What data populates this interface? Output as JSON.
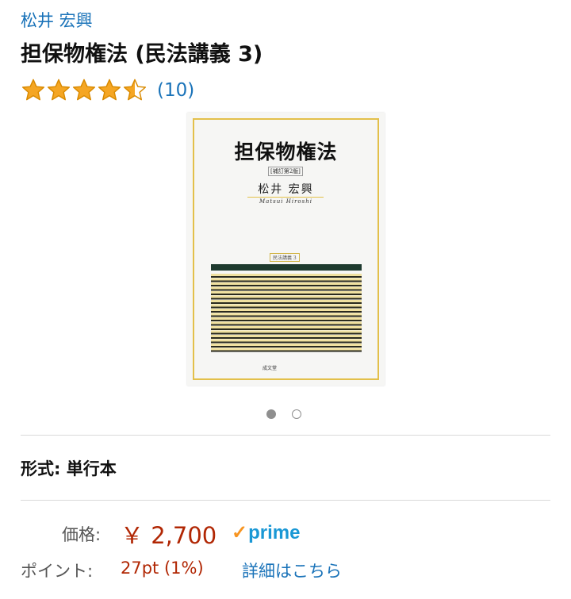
{
  "product": {
    "author": "松井 宏興",
    "title": "担保物権法 (民法講義 3)",
    "rating": {
      "stars": 4.5,
      "max_stars": 5,
      "count_text": "(10)"
    }
  },
  "cover": {
    "title": "担保物権法",
    "edition": "[補訂第2版]",
    "author": "松井 宏興",
    "author_en": "Matsui  Hiroshi",
    "series": "民法講義 3",
    "publisher": "成文堂"
  },
  "carousel": {
    "pages": 2,
    "active_index": 0
  },
  "format": {
    "text": "形式: 単行本"
  },
  "price": {
    "label": "価格:",
    "value": "￥ 2,700",
    "prime_check": "✓",
    "prime_text": "prime"
  },
  "points": {
    "label": "ポイント:",
    "value": "27pt  (1%)",
    "link": "詳細はこちら"
  },
  "colors": {
    "link": "#1a73b9",
    "price": "#b12704",
    "star": "#f5a623",
    "prime": "#1a98d5",
    "prime_check": "#f79420"
  }
}
